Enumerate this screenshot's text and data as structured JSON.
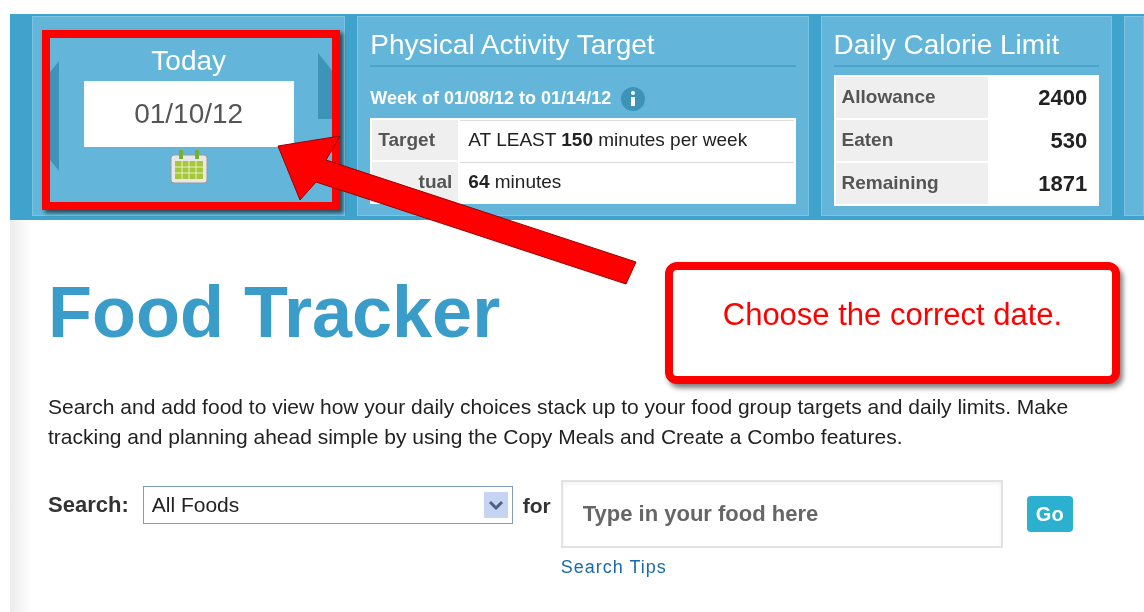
{
  "date_panel": {
    "title": "Today",
    "date": "01/10/12"
  },
  "activity_panel": {
    "title": "Physical Activity Target",
    "week": "Week of 01/08/12 to 01/14/12",
    "rows": [
      {
        "label": "Target",
        "value": "AT LEAST **150** minutes per week"
      },
      {
        "label": "tual",
        "value": "**64** minutes"
      }
    ]
  },
  "calorie_panel": {
    "title": "Daily Calorie Limit",
    "rows": [
      {
        "label": "Allowance",
        "value": "2400"
      },
      {
        "label": "Eaten",
        "value": "530"
      },
      {
        "label": "Remaining",
        "value": "1871"
      }
    ]
  },
  "page": {
    "title": "Food Tracker",
    "intro": "Search and add food to view how your daily choices stack up to your food group targets and daily limits. Make tracking and planning ahead simple by using the Copy Meals and Create a Combo features."
  },
  "search": {
    "label": "Search:",
    "category": "All Foods",
    "for_label": "for",
    "placeholder": "Type in your food here",
    "button": "Go",
    "tips_link": "Search Tips"
  },
  "annotation": {
    "callout": "Choose the correct date."
  }
}
